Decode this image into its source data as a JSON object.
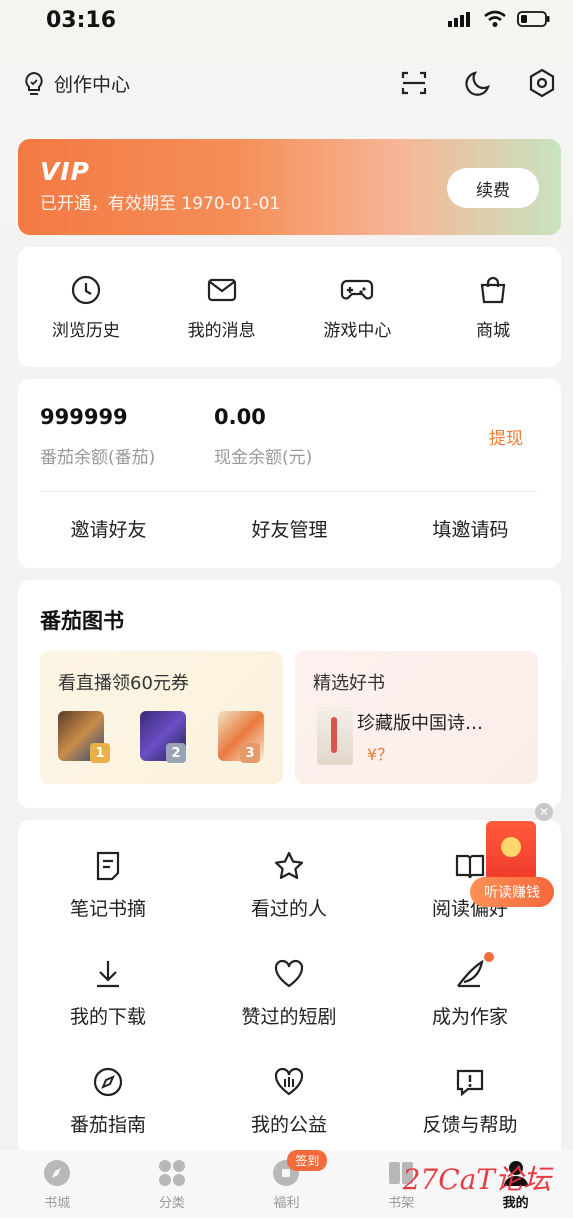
{
  "status_bar": {
    "time": "03:16"
  },
  "header": {
    "creator_label": "创作中心"
  },
  "vip": {
    "logo": "VIP",
    "subtitle": "已开通，有效期至 1970-01-01",
    "renew_label": "续费"
  },
  "quick_entries": [
    {
      "label": "浏览历史",
      "icon": "clock-icon"
    },
    {
      "label": "我的消息",
      "icon": "mail-icon"
    },
    {
      "label": "游戏中心",
      "icon": "gamepad-icon"
    },
    {
      "label": "商城",
      "icon": "shopping-bag-icon"
    }
  ],
  "wallet": {
    "coins_value": "999999",
    "coins_label": "番茄余额(番茄)",
    "cash_value": "0.00",
    "cash_label": "现金余额(元)",
    "withdraw_label": "提现",
    "links": [
      "邀请好友",
      "好友管理",
      "填邀请码"
    ]
  },
  "books": {
    "title": "番茄图书",
    "left_panel": {
      "title": "看直播领60元券",
      "ranks": [
        "1",
        "2",
        "3"
      ]
    },
    "right_panel": {
      "title": "精选好书",
      "book_name": "珍藏版中国诗…",
      "price": "¥？"
    }
  },
  "features": [
    {
      "label": "笔记书摘",
      "icon": "note-icon"
    },
    {
      "label": "看过的人",
      "icon": "star-icon"
    },
    {
      "label": "阅读偏好",
      "icon": "book-icon"
    },
    {
      "label": "我的下载",
      "icon": "download-icon"
    },
    {
      "label": "赞过的短剧",
      "icon": "heart-icon"
    },
    {
      "label": "成为作家",
      "icon": "feather-pen-icon"
    },
    {
      "label": "番茄指南",
      "icon": "compass-icon"
    },
    {
      "label": "我的公益",
      "icon": "charity-heart-icon"
    },
    {
      "label": "反馈与帮助",
      "icon": "feedback-icon"
    }
  ],
  "floating_promo": {
    "label": "听读赚钱"
  },
  "tabs": [
    {
      "label": "书城"
    },
    {
      "label": "分类"
    },
    {
      "label": "福利",
      "badge": "签到"
    },
    {
      "label": "书架"
    },
    {
      "label": "我的"
    }
  ],
  "watermark": "27CaT论坛",
  "colors": {
    "accent": "#f07b33",
    "vip_gradient_start": "#f47a43",
    "vip_gradient_end": "#c8e3c0"
  }
}
